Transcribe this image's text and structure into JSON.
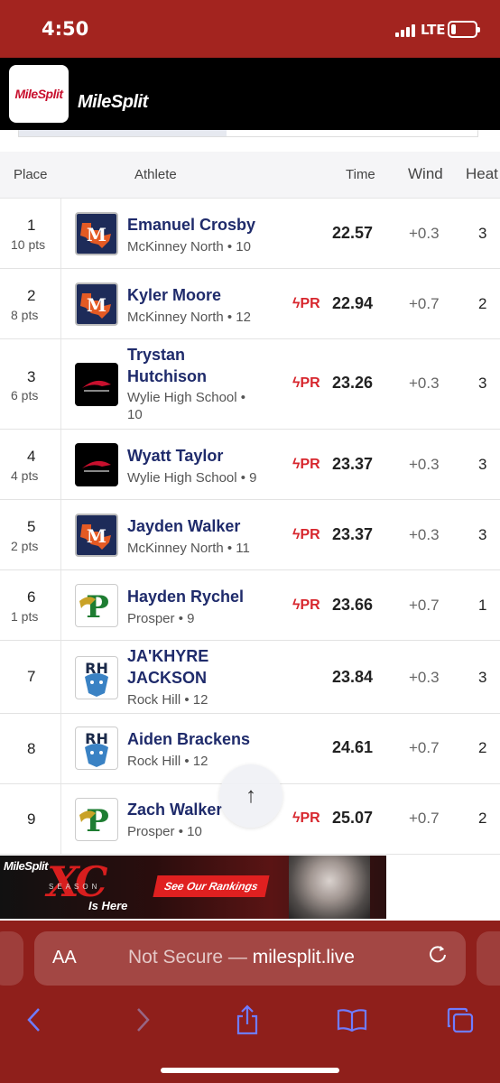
{
  "status_bar": {
    "time": "4:50",
    "network": "LTE"
  },
  "header": {
    "app_icon_label": "MileSplit",
    "logo_text": "MileSplit"
  },
  "table": {
    "columns": {
      "place": "Place",
      "athlete": "Athlete",
      "time": "Time",
      "wind": "Wind",
      "heat": "Heat"
    },
    "rows": [
      {
        "place": "1",
        "points": "10 pts",
        "name": "Emanuel Crosby",
        "team": "McKinney North • 10",
        "pr": "",
        "time": "22.57",
        "wind": "+0.3",
        "heat": "3"
      },
      {
        "place": "2",
        "points": "8 pts",
        "name": "Kyler Moore",
        "team": "McKinney North • 12",
        "pr": "PR",
        "time": "22.94",
        "wind": "+0.7",
        "heat": "2"
      },
      {
        "place": "3",
        "points": "6 pts",
        "name": "Trystan Hutchison",
        "name_line1": "Trystan",
        "name_line2": "Hutchison",
        "team": "Wylie High School • 10",
        "team_line1": "Wylie High School •",
        "team_line2": "10",
        "pr": "PR",
        "time": "23.26",
        "wind": "+0.3",
        "heat": "3"
      },
      {
        "place": "4",
        "points": "4 pts",
        "name": "Wyatt Taylor",
        "team": "Wylie High School • 9",
        "pr": "PR",
        "time": "23.37",
        "wind": "+0.3",
        "heat": "3"
      },
      {
        "place": "5",
        "points": "2 pts",
        "name": "Jayden Walker",
        "team": "McKinney North • 11",
        "pr": "PR",
        "time": "23.37",
        "wind": "+0.3",
        "heat": "3"
      },
      {
        "place": "6",
        "points": "1 pts",
        "name": "Hayden Rychel",
        "team": "Prosper • 9",
        "pr": "PR",
        "time": "23.66",
        "wind": "+0.7",
        "heat": "1"
      },
      {
        "place": "7",
        "points": "",
        "name": "JA'KHYRE JACKSON",
        "name_line1": "JA'KHYRE",
        "name_line2": "JACKSON",
        "team": "Rock Hill • 12",
        "pr": "",
        "time": "23.84",
        "wind": "+0.3",
        "heat": "3"
      },
      {
        "place": "8",
        "points": "",
        "name": "Aiden Brackens",
        "team": "Rock Hill • 12",
        "pr": "",
        "time": "24.61",
        "wind": "+0.7",
        "heat": "2"
      },
      {
        "place": "9",
        "points": "",
        "name": "Zach Walker",
        "team": "Prosper • 10",
        "pr": "PR",
        "time": "25.07",
        "wind": "+0.7",
        "heat": "2"
      }
    ]
  },
  "ad": {
    "brand": "MileSplit",
    "headline": "XC",
    "season": "SEASON",
    "tagline": "Is Here",
    "cta": "See Our Rankings"
  },
  "browser": {
    "aa_label": "AA",
    "url_prefix": "Not Secure — ",
    "url": "milesplit.live"
  },
  "colors": {
    "status_bar": "#a3241f",
    "chrome": "#8f1f1b",
    "athlete_link": "#1f2b6b",
    "pr_red": "#d7262d"
  }
}
